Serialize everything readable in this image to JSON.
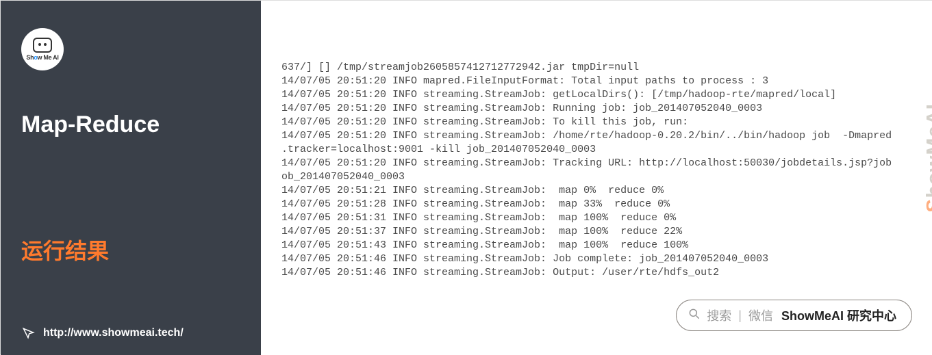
{
  "sidebar": {
    "logo_text_prefix": "Sh",
    "logo_text_o": "o",
    "logo_text_suffix": "w Me AI",
    "title": "Map-Reduce",
    "subtitle": "运行结果",
    "footer_url": "http://www.showmeai.tech/"
  },
  "log_lines": [
    "637/] [] /tmp/streamjob2605857412712772942.jar tmpDir=null",
    "14/07/05 20:51:20 INFO mapred.FileInputFormat: Total input paths to process : 3",
    "14/07/05 20:51:20 INFO streaming.StreamJob: getLocalDirs(): [/tmp/hadoop-rte/mapred/local]",
    "14/07/05 20:51:20 INFO streaming.StreamJob: Running job: job_201407052040_0003",
    "14/07/05 20:51:20 INFO streaming.StreamJob: To kill this job, run:",
    "14/07/05 20:51:20 INFO streaming.StreamJob: /home/rte/hadoop-0.20.2/bin/../bin/hadoop job  -Dmapred",
    ".tracker=localhost:9001 -kill job_201407052040_0003",
    "14/07/05 20:51:20 INFO streaming.StreamJob: Tracking URL: http://localhost:50030/jobdetails.jsp?job",
    "ob_201407052040_0003",
    "14/07/05 20:51:21 INFO streaming.StreamJob:  map 0%  reduce 0%",
    "14/07/05 20:51:28 INFO streaming.StreamJob:  map 33%  reduce 0%",
    "14/07/05 20:51:31 INFO streaming.StreamJob:  map 100%  reduce 0%",
    "14/07/05 20:51:37 INFO streaming.StreamJob:  map 100%  reduce 22%",
    "14/07/05 20:51:43 INFO streaming.StreamJob:  map 100%  reduce 100%",
    "14/07/05 20:51:46 INFO streaming.StreamJob: Job complete: job_201407052040_0003",
    "14/07/05 20:51:46 INFO streaming.StreamJob: Output: /user/rte/hdfs_out2"
  ],
  "watermark": {
    "s": "S",
    "rest": "howMeAI"
  },
  "search": {
    "hint_search": "搜索",
    "hint_wechat": "微信",
    "brand": "ShowMeAI 研究中心"
  }
}
